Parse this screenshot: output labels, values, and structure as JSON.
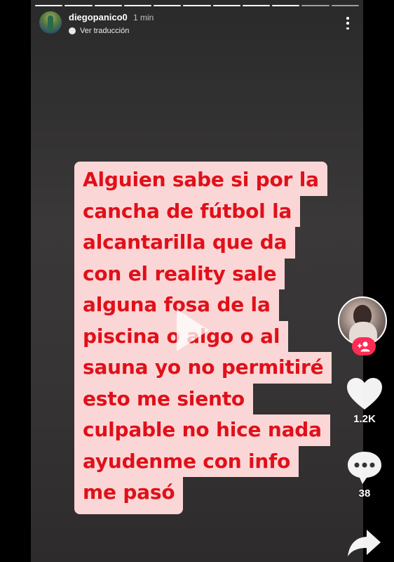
{
  "story": {
    "username": "diegopanico0",
    "timestamp": "1 min",
    "translate_label": "Ver traducción",
    "progress_segments": 11,
    "text_lines": [
      "Alguien sabe si por la",
      "cancha de fútbol la",
      "alcantarilla que da",
      "con el reality sale",
      "alguna fosa de la",
      "piscina o algo o al",
      "sauna yo no permitiré",
      "esto me siento",
      "culpable no hice nada",
      "ayudenme con info",
      "me pasó"
    ]
  },
  "sidebar": {
    "likes": "1.2K",
    "comments": "38"
  },
  "colors": {
    "text_highlight": "#fbd6d6",
    "text_red": "#e0101a",
    "follow_badge": "#fe2c55"
  },
  "icons": {
    "more": "more-vertical-icon",
    "translate": "translate-icon",
    "play": "play-icon",
    "follow": "add-user-icon",
    "like": "heart-icon",
    "comment": "comment-icon",
    "share": "share-icon"
  }
}
